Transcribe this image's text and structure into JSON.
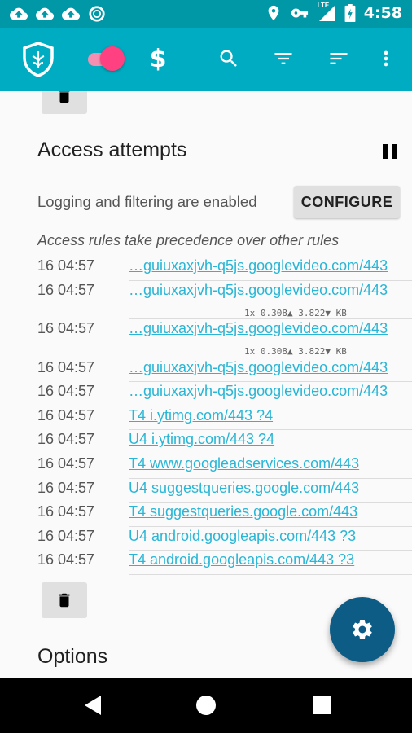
{
  "status_bar": {
    "time": "4:58",
    "network": "LTE",
    "left_icons": [
      "cloud-upload-icon",
      "cloud-upload-icon",
      "cloud-upload-icon",
      "sync-circle-icon"
    ],
    "right_icons": [
      "location-icon",
      "key-icon",
      "signal-icon",
      "battery-charging-icon"
    ]
  },
  "app_bar": {
    "color": "#00acc1",
    "icons": [
      "shield-logo-icon",
      "toggle-switch",
      "dollar-icon",
      "search-icon",
      "filter-icon",
      "sort-icon",
      "more-vert-icon"
    ],
    "toggle_on": true
  },
  "access": {
    "title": "Access attempts",
    "logging_text": "Logging and filtering are enabled",
    "configure_label": "CONFIGURE",
    "rules_note": "Access rules take precedence over other rules",
    "rows": [
      {
        "time": "16 04:57",
        "dest": "…guiuxaxjvh-q5js.googlevideo.com/443",
        "stats": ""
      },
      {
        "time": "16 04:57",
        "dest": "…guiuxaxjvh-q5js.googlevideo.com/443",
        "stats": "1x   0.308▲   3.822▼ KB"
      },
      {
        "time": "16 04:57",
        "dest": "…guiuxaxjvh-q5js.googlevideo.com/443",
        "stats": "1x   0.308▲   3.822▼ KB"
      },
      {
        "time": "16 04:57",
        "dest": "…guiuxaxjvh-q5js.googlevideo.com/443",
        "stats": ""
      },
      {
        "time": "16 04:57",
        "dest": "…guiuxaxjvh-q5js.googlevideo.com/443",
        "stats": ""
      },
      {
        "time": "16 04:57",
        "dest": "T4 i.ytimg.com/443 ?4",
        "stats": ""
      },
      {
        "time": "16 04:57",
        "dest": "U4 i.ytimg.com/443 ?4",
        "stats": ""
      },
      {
        "time": "16 04:57",
        "dest": "T4 www.googleadservices.com/443",
        "stats": ""
      },
      {
        "time": "16 04:57",
        "dest": "U4 suggestqueries.google.com/443",
        "stats": ""
      },
      {
        "time": "16 04:57",
        "dest": "T4 suggestqueries.google.com/443",
        "stats": ""
      },
      {
        "time": "16 04:57",
        "dest": "U4 android.googleapis.com/443 ?3",
        "stats": ""
      },
      {
        "time": "16 04:57",
        "dest": "T4 android.googleapis.com/443 ?3",
        "stats": ""
      }
    ]
  },
  "options": {
    "title": "Options"
  },
  "fab": {
    "icon": "settings-gear-icon",
    "color": "#0d5c86"
  },
  "nav_bar": {
    "icons": [
      "back-icon",
      "home-icon",
      "recents-icon"
    ]
  }
}
